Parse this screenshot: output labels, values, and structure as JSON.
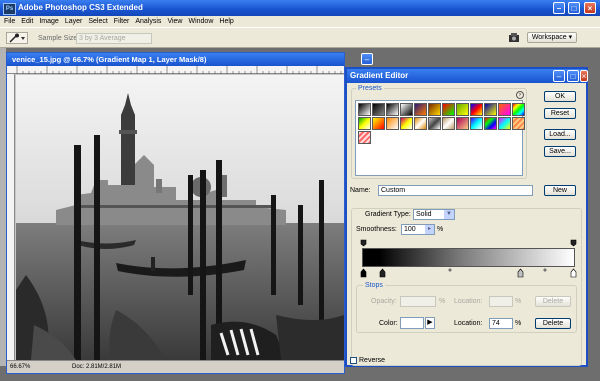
{
  "app": {
    "title": "Adobe Photoshop CS3 Extended"
  },
  "menu": [
    "File",
    "Edit",
    "Image",
    "Layer",
    "Select",
    "Filter",
    "Analysis",
    "View",
    "Window",
    "Help"
  ],
  "options_bar": {
    "sample_size_label": "Sample Size:",
    "sample_size_value": "3 by 3 Average",
    "workspace_label": "Workspace"
  },
  "document": {
    "title": "venice_15.jpg @ 66.7% (Gradient Map 1, Layer Mask/8)",
    "zoom": "66.67%",
    "doc_info": "Doc: 2.81M/2.81M"
  },
  "dialog": {
    "title": "Gradient Editor",
    "presets_label": "Presets",
    "buttons": {
      "ok": "OK",
      "reset": "Reset",
      "load": "Load...",
      "save": "Save...",
      "new": "New",
      "delete": "Delete"
    },
    "name_label": "Name:",
    "name_value": "Custom",
    "gradient_type_label": "Gradient Type:",
    "gradient_type_value": "Solid",
    "smoothness_label": "Smoothness:",
    "smoothness_value": "100",
    "percent": "%",
    "stops_label": "Stops",
    "opacity_label": "Opacity:",
    "location_label": "Location:",
    "color_label": "Color:",
    "color_location_value": "74",
    "reverse_label": "Reverse"
  },
  "colors": {
    "title_blue": "#1853cf",
    "dialog_bg": "#ece9d8",
    "accent_blue": "#1957c8"
  },
  "icons": [
    "photoshop-logo-icon",
    "eyedropper-icon",
    "minimize-icon",
    "maximize-icon",
    "close-icon",
    "flyout-arrow-icon",
    "dropdown-arrow-icon",
    "stepper-arrow-icon",
    "color-picker-arrow-icon"
  ]
}
